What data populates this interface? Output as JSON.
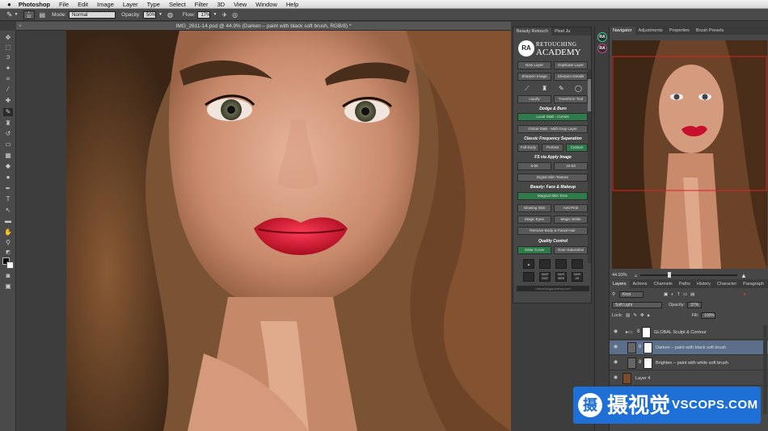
{
  "menubar": {
    "apple": "",
    "app": "Photoshop",
    "items": [
      "File",
      "Edit",
      "Image",
      "Layer",
      "Type",
      "Select",
      "Filter",
      "3D",
      "View",
      "Window",
      "Help"
    ]
  },
  "options": {
    "size": "10",
    "mode_label": "Mode:",
    "mode_value": "Normal",
    "opacity_label": "Opacity:",
    "opacity_value": "50%",
    "flow_label": "Flow:",
    "flow_value": "17%"
  },
  "document": {
    "tab_title": "IMG_2611-14.psd @ 44.9% (Darken – paint with black soft brush, RGB/8) *",
    "close": "×"
  },
  "retouch_panel": {
    "tabs": [
      "Beauty Retouch",
      "Pixel Ju"
    ],
    "logo_mark": "RA",
    "logo_line1": "RETOUCHING",
    "logo_line2": "ACADEMY",
    "buttons_top": [
      "New Layer",
      "Duplicate Layer",
      "Sharpen Image",
      "Sharpen Details"
    ],
    "tool_buttons": [
      "Liquify",
      "Transform Tool"
    ],
    "section_dodge": "Dodge & Burn",
    "dodge_buttons": [
      "Local D&B - Curves",
      "Global D&B - Midt Gray Layer"
    ],
    "section_freq": "Classic Frequency Separation",
    "freq_buttons": [
      "Full-body",
      "Portrait",
      "Custom"
    ],
    "section_fs": "FS via Apply Image",
    "fs_buttons": [
      "8-bit",
      "16-bit",
      "Digital Skin Texture"
    ],
    "section_beauty": "Beauty: Face & Makeup",
    "beauty_buttons": [
      "Magical Skin Tone",
      "Glowing Skin",
      "Anti-Pink",
      "Magic Eyes",
      "Magic Smile",
      "Remove Body & Facial Hair"
    ],
    "section_quality": "Quality Control",
    "quality_buttons": [
      "Solar Curve",
      "Over-Saturation"
    ],
    "icon_labels": [
      "",
      "",
      "",
      "",
      "",
      "SAVE SIZE",
      "SAVE WEB",
      "SAVE AS"
    ],
    "footer": "retouchingacademy.com"
  },
  "side_badges": [
    "RA",
    "RA"
  ],
  "navigator": {
    "tabs": [
      "Navigator",
      "Adjustments",
      "Properties",
      "Brush Presets"
    ],
    "zoom": "44.93%"
  },
  "layers": {
    "tabs": [
      "Layers",
      "Actions",
      "Channels",
      "Paths",
      "History",
      "Character",
      "Paragraph"
    ],
    "kind": "Kind",
    "blend": "Soft Light",
    "opacity_label": "Opacity:",
    "opacity": "37%",
    "lock_label": "Lock:",
    "fill_label": "Fill:",
    "fill": "100%",
    "rows": [
      {
        "name": "GLOBAL Sculpt & Contour"
      },
      {
        "name": "Darken – paint with black soft brush"
      },
      {
        "name": "Brighten – paint with white soft brush"
      },
      {
        "name": "Layer 4"
      }
    ]
  },
  "watermark": {
    "cn": "摄视觉",
    "en": "VSCOPS.COM"
  },
  "colors": {
    "accent_green": "#2f7a4a",
    "selection_blue": "#5b6e8a",
    "watermark_blue": "#1e6fd6",
    "lip_red": "#c8102e"
  }
}
